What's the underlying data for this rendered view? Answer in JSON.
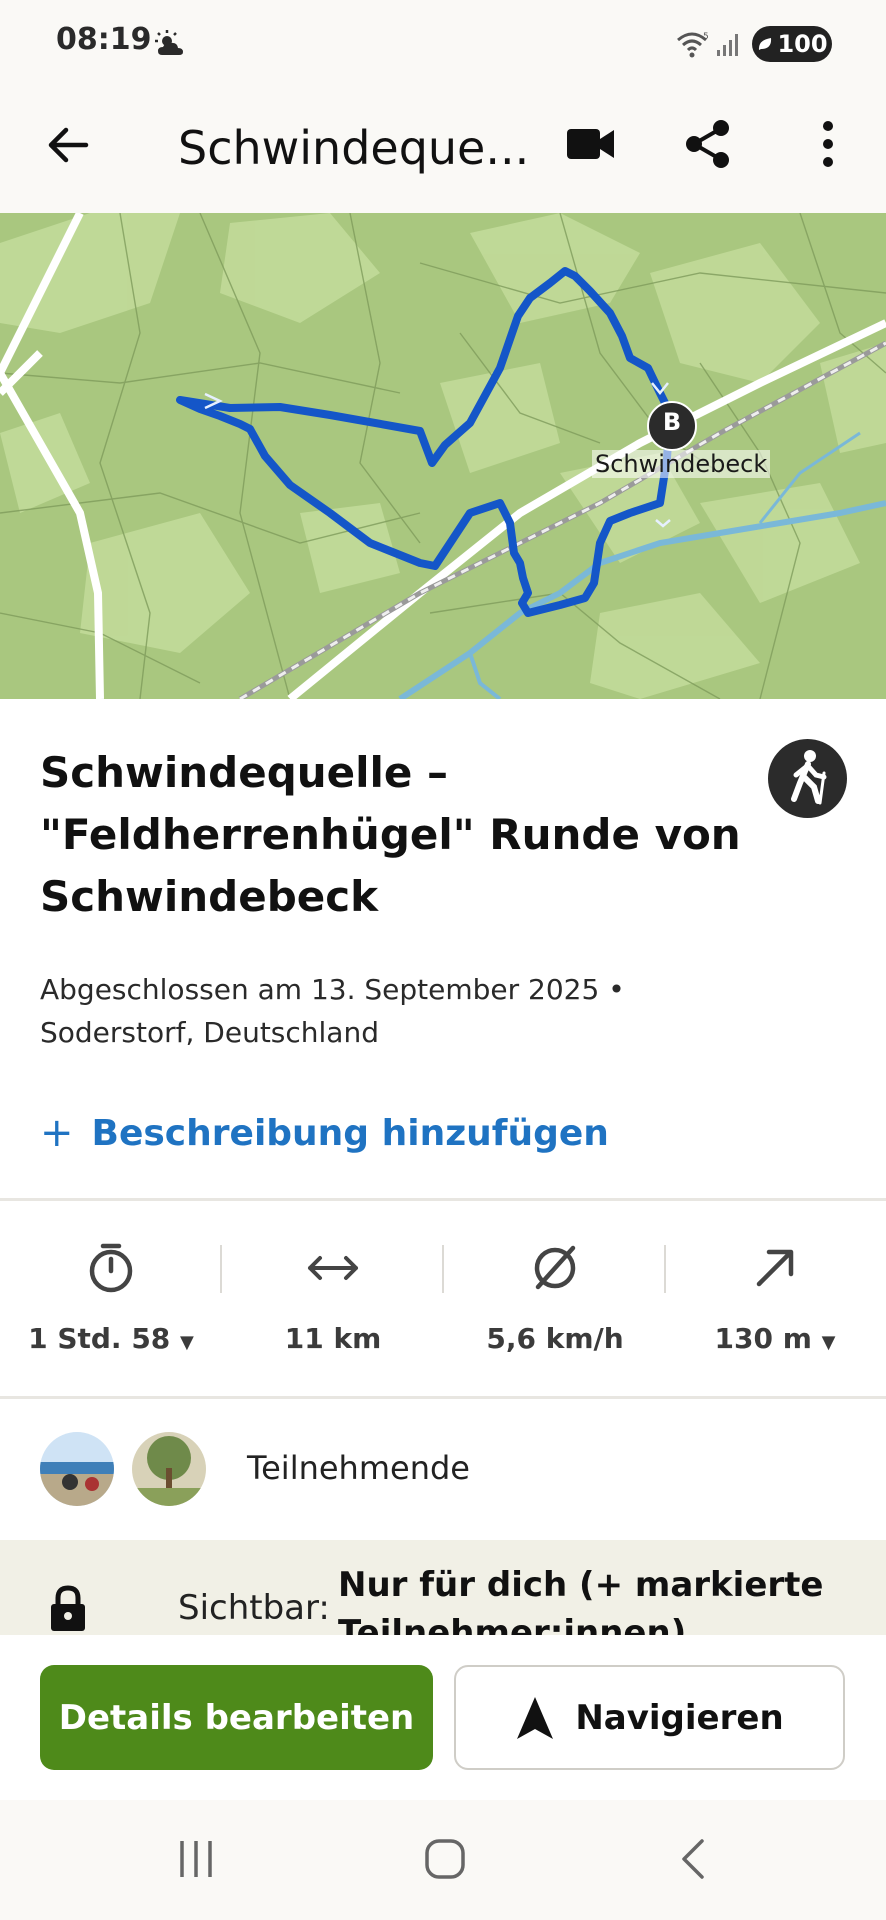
{
  "status_bar": {
    "time": "08:19",
    "battery": "100"
  },
  "toolbar": {
    "title": "Schwindeque..."
  },
  "map": {
    "marker_label": "B",
    "place_label": "Schwindebeck"
  },
  "tour": {
    "title": "Schwindequelle – \"Feldherrenhügel\" Runde von Schwindebeck",
    "completed": "Abgeschlossen am 13. September 2025 •",
    "location": "Soderstorf, Deutschland",
    "add_description_plus": "+",
    "add_description": "Beschreibung hinzufügen",
    "sport_icon": "hiking-icon"
  },
  "stats": [
    {
      "icon": "stopwatch-icon",
      "value": "1 Std. 58",
      "dropdown": true
    },
    {
      "icon": "distance-arrows-icon",
      "value": "11 km",
      "dropdown": false
    },
    {
      "icon": "average-speed-icon",
      "value": "5,6 km/h",
      "dropdown": false
    },
    {
      "icon": "elevation-up-icon",
      "value": "130 m",
      "dropdown": true
    }
  ],
  "participants": {
    "label": "Teilnehmende"
  },
  "visibility": {
    "label": "Sichtbar:",
    "value": "Nur für dich (+ markierte Teilnehmer:innen)"
  },
  "actions": {
    "edit_details": "Details bearbeiten",
    "navigate": "Navigieren"
  },
  "colors": {
    "brand_green": "#4e8a1a",
    "link_blue": "#1f73c2",
    "route_blue": "#1456c8",
    "map_green": "#a9c77f"
  }
}
